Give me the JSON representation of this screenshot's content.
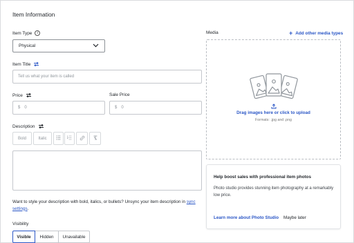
{
  "page": {
    "title": "Item Information"
  },
  "item_type": {
    "label": "Item Type",
    "value": "Physical"
  },
  "item_title": {
    "label": "Item Title",
    "placeholder": "Tell us what your item is called"
  },
  "price": {
    "label": "Price",
    "currency": "$",
    "value": "0"
  },
  "sale_price": {
    "label": "Sale Price",
    "currency": "$",
    "value": "0"
  },
  "description": {
    "label": "Description",
    "toolbar": {
      "bold": "Bold",
      "italic": "Italic"
    }
  },
  "help": {
    "text": "Want to style your description with bold, italics, or bullets? Unsync your item description in ",
    "link": "sync settings",
    "end": "."
  },
  "visibility": {
    "label": "Visibility",
    "options": [
      "Visible",
      "Hidden",
      "Unavailable"
    ],
    "selected": "Visible"
  },
  "media": {
    "label": "Media",
    "add_link": "Add other media types",
    "drag_text": "Drag images here or click to upload",
    "formats": "Formats: .jpg and .png"
  },
  "promo": {
    "title": "Help boost sales with professional item photos",
    "body": "Photo studio provides stunning item photography at a remarkably low price.",
    "link": "Learn more about Photo Studio",
    "dismiss": "Maybe later"
  },
  "colors": {
    "accent": "#2a56c6",
    "border": "#c4c7cc",
    "text": "#1f2328"
  }
}
